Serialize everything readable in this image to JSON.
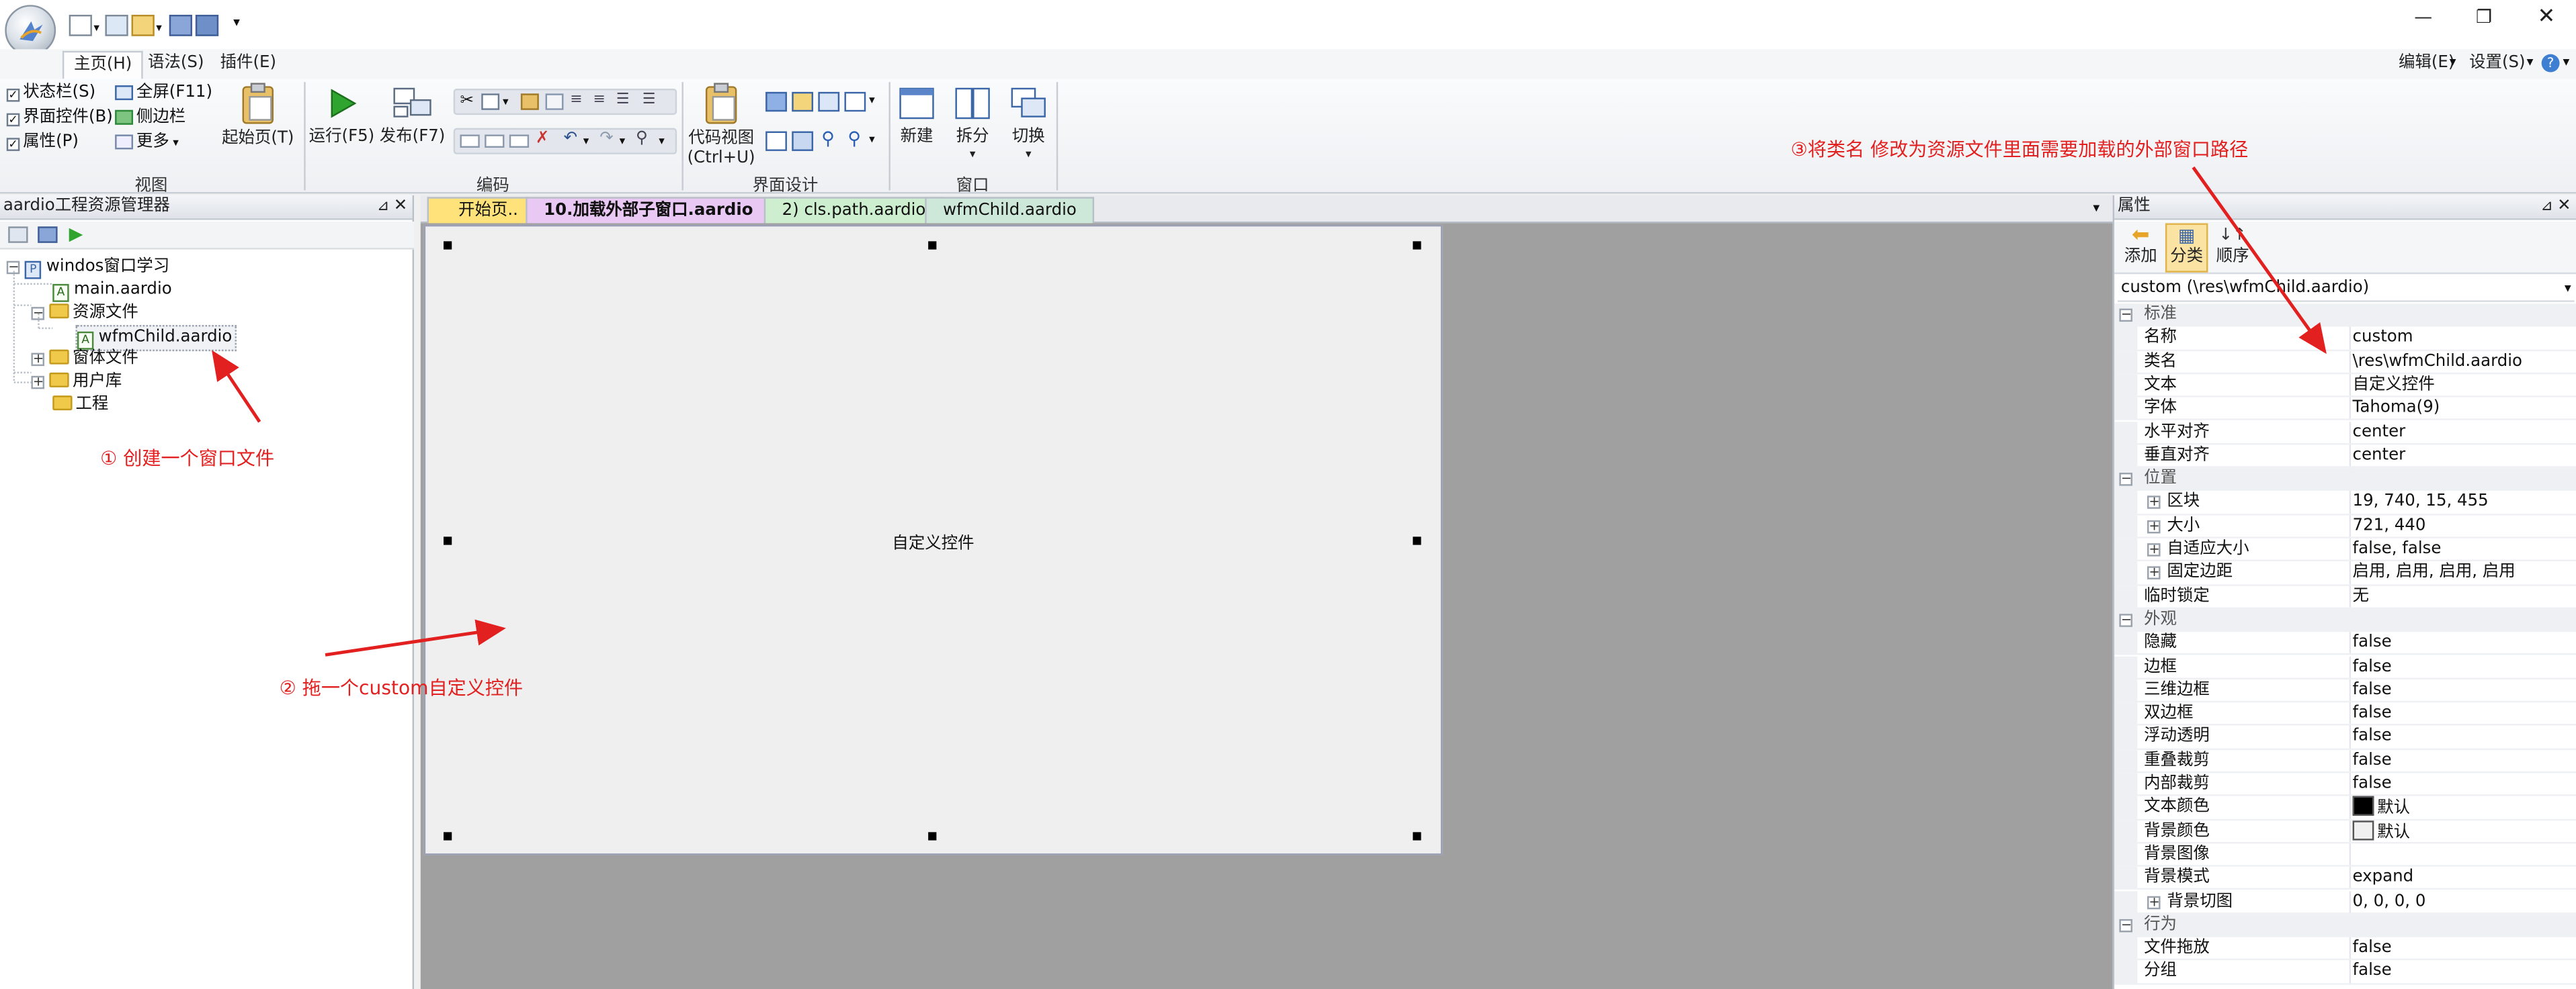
{
  "toolbar_tabs": [
    "主页(H)",
    "语法(S)",
    "插件(E)"
  ],
  "top_right": {
    "edit": "编辑(E)",
    "settings": "设置(S)"
  },
  "ribbon": {
    "view": {
      "statusbar": "状态栏(S)",
      "ui_controls": "界面控件(B)",
      "properties": "属性(P)",
      "fullscreen": "全屏(F11)",
      "sidebar": "侧边栏",
      "more": "更多",
      "start_page": "起始页(T)",
      "label": "视图"
    },
    "code": {
      "run": "运行(F5)",
      "publish": "发布(F7)",
      "label": "编码"
    },
    "ui_design": {
      "code_view_1": "代码视图",
      "code_view_2": "(Ctrl+U)",
      "label": "界面设计"
    },
    "window": {
      "new": "新建",
      "split": "拆分",
      "switch": "切换",
      "label": "窗口"
    }
  },
  "project": {
    "title": "aardio工程资源管理器",
    "root": "windos窗口学习",
    "main": "main.aardio",
    "res_folder": "资源文件",
    "res_file": "wfmChild.aardio",
    "forms": "窗体文件",
    "userlib": "用户库",
    "project": "工程"
  },
  "doc_tabs": [
    "开始页..",
    "10.加载外部子窗口.aardio",
    "2) cls.path.aardio",
    "wfmChild.aardio"
  ],
  "form": {
    "control_text": "自定义控件"
  },
  "properties": {
    "title": "属性",
    "tb_add": "添加",
    "tb_category": "分类",
    "tb_order": "顺序",
    "selector": "custom (\\res\\wfmChild.aardio)",
    "rows": [
      {
        "cat": true,
        "name": "标准"
      },
      {
        "name": "名称",
        "value": "custom"
      },
      {
        "name": "类名",
        "value": "\\res\\wfmChild.aardio"
      },
      {
        "name": "文本",
        "value": "自定义控件"
      },
      {
        "name": "字体",
        "value": "Tahoma(9)"
      },
      {
        "name": "水平对齐",
        "value": "center"
      },
      {
        "name": "垂直对齐",
        "value": "center"
      },
      {
        "cat": true,
        "name": "位置"
      },
      {
        "name": "区块",
        "value": "19, 740, 15, 455",
        "exp": true
      },
      {
        "name": "大小",
        "value": "721, 440",
        "exp": true
      },
      {
        "name": "自适应大小",
        "value": "false, false",
        "exp": true
      },
      {
        "name": "固定边距",
        "value": "启用, 启用, 启用, 启用",
        "exp": true
      },
      {
        "name": "临时锁定",
        "value": "无"
      },
      {
        "cat": true,
        "name": "外观"
      },
      {
        "name": "隐藏",
        "value": "false"
      },
      {
        "name": "边框",
        "value": "false"
      },
      {
        "name": "三维边框",
        "value": "false"
      },
      {
        "name": "双边框",
        "value": "false"
      },
      {
        "name": "浮动透明",
        "value": "false"
      },
      {
        "name": "重叠裁剪",
        "value": "false"
      },
      {
        "name": "内部裁剪",
        "value": "false"
      },
      {
        "name": "文本颜色",
        "value": "默认",
        "swatch": "#000000"
      },
      {
        "name": "背景颜色",
        "value": "默认",
        "swatch": "#f0f0f0"
      },
      {
        "name": "背景图像",
        "value": ""
      },
      {
        "name": "背景模式",
        "value": "expand"
      },
      {
        "name": "背景切图",
        "value": "0, 0, 0, 0",
        "exp": true
      },
      {
        "cat": true,
        "name": "行为"
      },
      {
        "name": "文件拖放",
        "value": "false"
      },
      {
        "name": "分组",
        "value": "false"
      }
    ]
  },
  "annotations": {
    "a1": "① 创建一个窗口文件",
    "a2": "② 拖一个custom自定义控件",
    "a3": "③将类名 修改为资源文件里面需要加载的外部窗口路径"
  },
  "colors": {
    "annotation": "#e32020",
    "tab_active": "#e9c8f3",
    "tab_start": "#ffe27a",
    "tab_path": "#cdeecf",
    "tab_child": "#cde8d9"
  }
}
